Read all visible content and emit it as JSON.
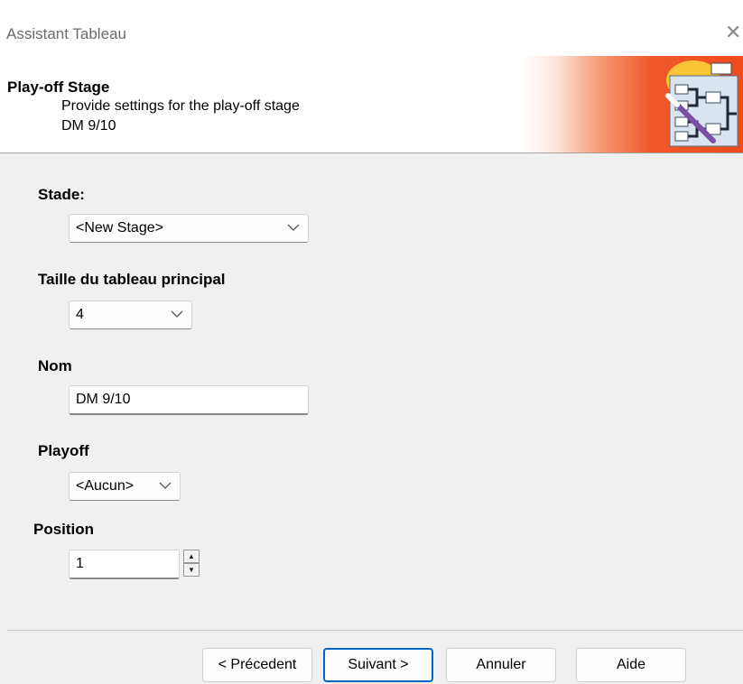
{
  "window": {
    "title": "Assistant Tableau",
    "close_glyph": "✕"
  },
  "header": {
    "title": "Play-off Stage",
    "subtitle": "Provide settings for the play-off stage",
    "detail": "DM 9/10",
    "logo_icon": "bracket-wand-icon"
  },
  "form": {
    "stage": {
      "label": "Stade:",
      "value": "<New Stage>"
    },
    "draw_size": {
      "label": "Taille du tableau principal",
      "value": "4"
    },
    "name": {
      "label": "Nom",
      "value": "DM 9/10"
    },
    "playoff": {
      "label": "Playoff",
      "value": "<Aucun>"
    },
    "position": {
      "label": "Position",
      "value": "1",
      "up": "▲",
      "down": "▼"
    }
  },
  "buttons": {
    "previous": "< Précedent",
    "next": "Suivant >",
    "cancel": "Annuler",
    "help": "Aide"
  },
  "colors": {
    "accent": "#0067c0",
    "header_orange": "#ee4b1c"
  }
}
